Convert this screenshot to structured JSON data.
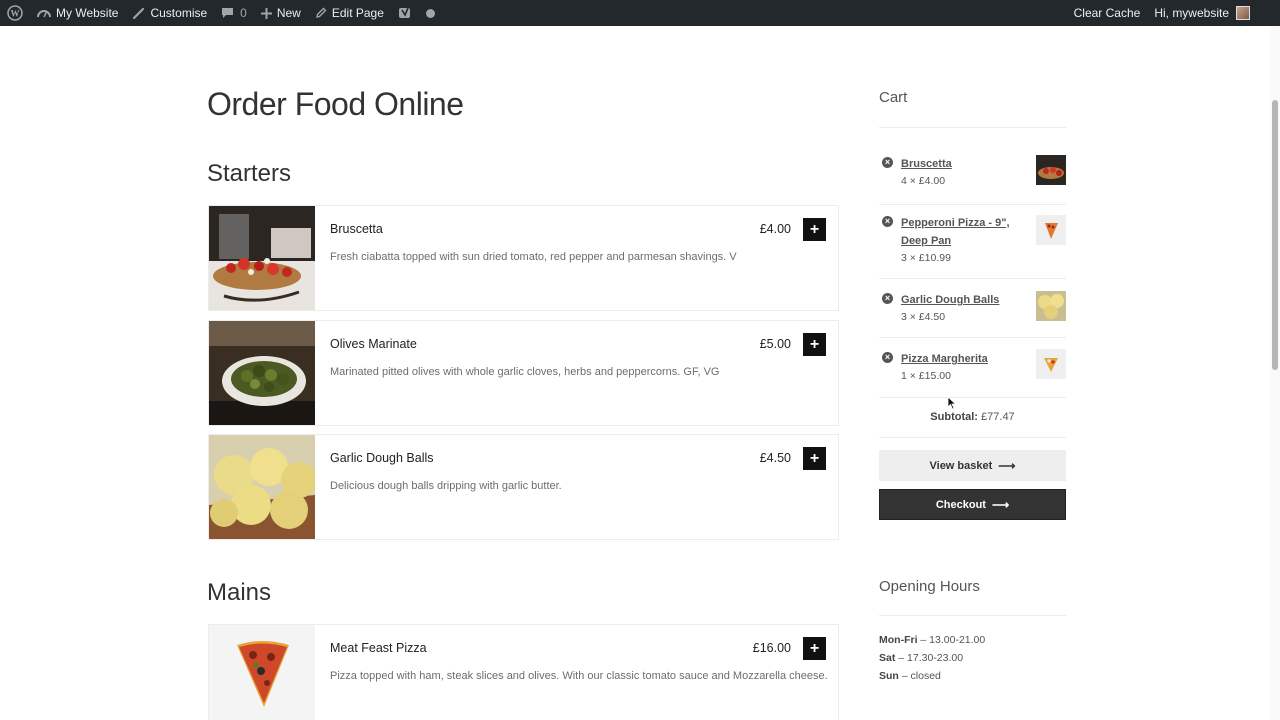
{
  "adminbar": {
    "site_name": "My Website",
    "customise": "Customise",
    "comments_count": "0",
    "new": "New",
    "edit_page": "Edit Page",
    "clear_cache": "Clear Cache",
    "greeting": "Hi, mywebsite"
  },
  "page": {
    "title": "Order Food Online"
  },
  "sections": {
    "starters": {
      "title": "Starters",
      "items": [
        {
          "name": "Bruscetta",
          "price": "£4.00",
          "desc": "Fresh ciabatta topped with sun dried tomato, red pepper and parmesan shavings. V"
        },
        {
          "name": "Olives Marinate",
          "price": "£5.00",
          "desc": "Marinated pitted olives with whole garlic cloves, herbs and peppercorns. GF, VG"
        },
        {
          "name": "Garlic Dough Balls",
          "price": "£4.50",
          "desc": "Delicious dough balls dripping with garlic butter."
        }
      ]
    },
    "mains": {
      "title": "Mains",
      "items": [
        {
          "name": "Meat Feast Pizza",
          "price": "£16.00",
          "desc": "Pizza topped with ham, steak slices and olives. With our classic tomato sauce and Mozzarella cheese."
        }
      ]
    }
  },
  "add_symbol": "+",
  "remove_symbol": "×",
  "cart": {
    "title": "Cart",
    "items": [
      {
        "name": "Bruscetta",
        "qty": "4 × £4.00"
      },
      {
        "name": "Pepperoni Pizza - 9\", Deep Pan",
        "qty": "3 × £10.99"
      },
      {
        "name": "Garlic Dough Balls",
        "qty": "3 × £4.50"
      },
      {
        "name": "Pizza Margherita",
        "qty": "1 × £15.00"
      }
    ],
    "subtotal_label": "Subtotal:",
    "subtotal_value": "£77.47",
    "view_basket": "View basket",
    "checkout": "Checkout",
    "arrow": "⟶"
  },
  "hours": {
    "title": "Opening Hours",
    "lines": [
      {
        "day": "Mon-Fri",
        "time": "– 13.00-21.00"
      },
      {
        "day": "Sat",
        "time": "– 17.30-23.00"
      },
      {
        "day": "Sun",
        "time": "– closed"
      }
    ]
  }
}
